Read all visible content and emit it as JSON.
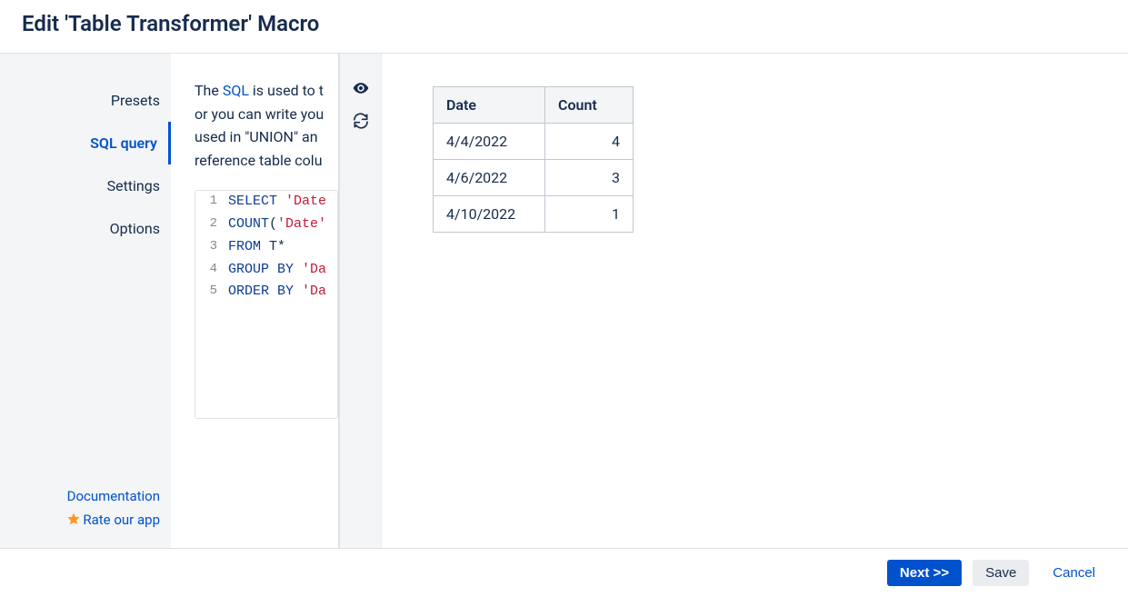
{
  "header": {
    "title": "Edit 'Table Transformer' Macro"
  },
  "sidebar": {
    "tabs": [
      {
        "label": "Presets",
        "active": false
      },
      {
        "label": "SQL query",
        "active": true
      },
      {
        "label": "Settings",
        "active": false
      },
      {
        "label": "Options",
        "active": false
      }
    ],
    "footer": {
      "documentation": "Documentation",
      "rate": "Rate our app"
    }
  },
  "description": {
    "pre_link": "The ",
    "link_text": "SQL",
    "post_link": " is used to t",
    "line2": "or you can write you",
    "line3": "used in \"UNION\" an",
    "line4": "reference table colu"
  },
  "code": {
    "lines": [
      {
        "num": "1",
        "tokens": [
          {
            "t": "SELECT ",
            "cls": "kw"
          },
          {
            "t": "'Date",
            "cls": "str"
          }
        ]
      },
      {
        "num": "2",
        "tokens": [
          {
            "t": "COUNT",
            "cls": "kw"
          },
          {
            "t": "(",
            "cls": "plain"
          },
          {
            "t": "'Date'",
            "cls": "str"
          }
        ]
      },
      {
        "num": "3",
        "tokens": [
          {
            "t": "FROM ",
            "cls": "kw"
          },
          {
            "t": "T*",
            "cls": "plain"
          }
        ]
      },
      {
        "num": "4",
        "tokens": [
          {
            "t": "GROUP BY ",
            "cls": "kw"
          },
          {
            "t": "'Da",
            "cls": "str"
          }
        ]
      },
      {
        "num": "5",
        "tokens": [
          {
            "t": "ORDER BY ",
            "cls": "kw"
          },
          {
            "t": "'Da",
            "cls": "str"
          }
        ]
      }
    ]
  },
  "strip": {
    "preview_icon": "preview",
    "refresh_icon": "refresh"
  },
  "result_table": {
    "headers": [
      "Date",
      "Count"
    ],
    "rows": [
      {
        "date": "4/4/2022",
        "count": "4"
      },
      {
        "date": "4/6/2022",
        "count": "3"
      },
      {
        "date": "4/10/2022",
        "count": "1"
      }
    ]
  },
  "footer": {
    "next": "Next >>",
    "save": "Save",
    "cancel": "Cancel"
  }
}
